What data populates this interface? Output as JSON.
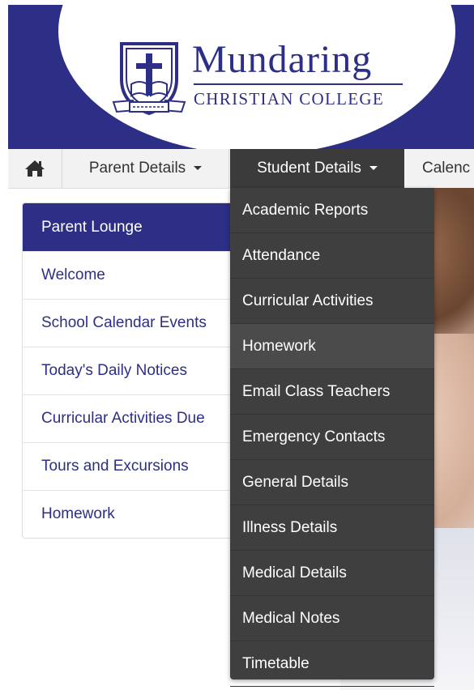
{
  "header": {
    "brand_name": "Mundaring",
    "brand_sub": "CHRISTIAN COLLEGE",
    "colors": {
      "brand": "#2d2f86",
      "white": "#ffffff"
    }
  },
  "nav": {
    "home_icon": "home-icon",
    "items": [
      {
        "label": "Parent Details"
      },
      {
        "label": "Student Details"
      },
      {
        "label": "Calenc"
      }
    ]
  },
  "sidebar": {
    "title": "Parent Lounge",
    "items": [
      {
        "label": "Welcome"
      },
      {
        "label": "School Calendar Events"
      },
      {
        "label": "Today's Daily Notices"
      },
      {
        "label": "Curricular Activities Due"
      },
      {
        "label": "Tours and Excursions"
      },
      {
        "label": "Homework"
      }
    ]
  },
  "dropdown": {
    "items": [
      {
        "label": "Academic Reports"
      },
      {
        "label": "Attendance"
      },
      {
        "label": "Curricular Activities"
      },
      {
        "label": "Homework"
      },
      {
        "label": "Email Class Teachers"
      },
      {
        "label": "Emergency Contacts"
      },
      {
        "label": "General Details"
      },
      {
        "label": "Illness Details"
      },
      {
        "label": "Medical Details"
      },
      {
        "label": "Medical Notes"
      },
      {
        "label": "Timetable"
      }
    ],
    "colors": {
      "background": "#3f3f3f",
      "hover": "#4b4b4b"
    }
  }
}
